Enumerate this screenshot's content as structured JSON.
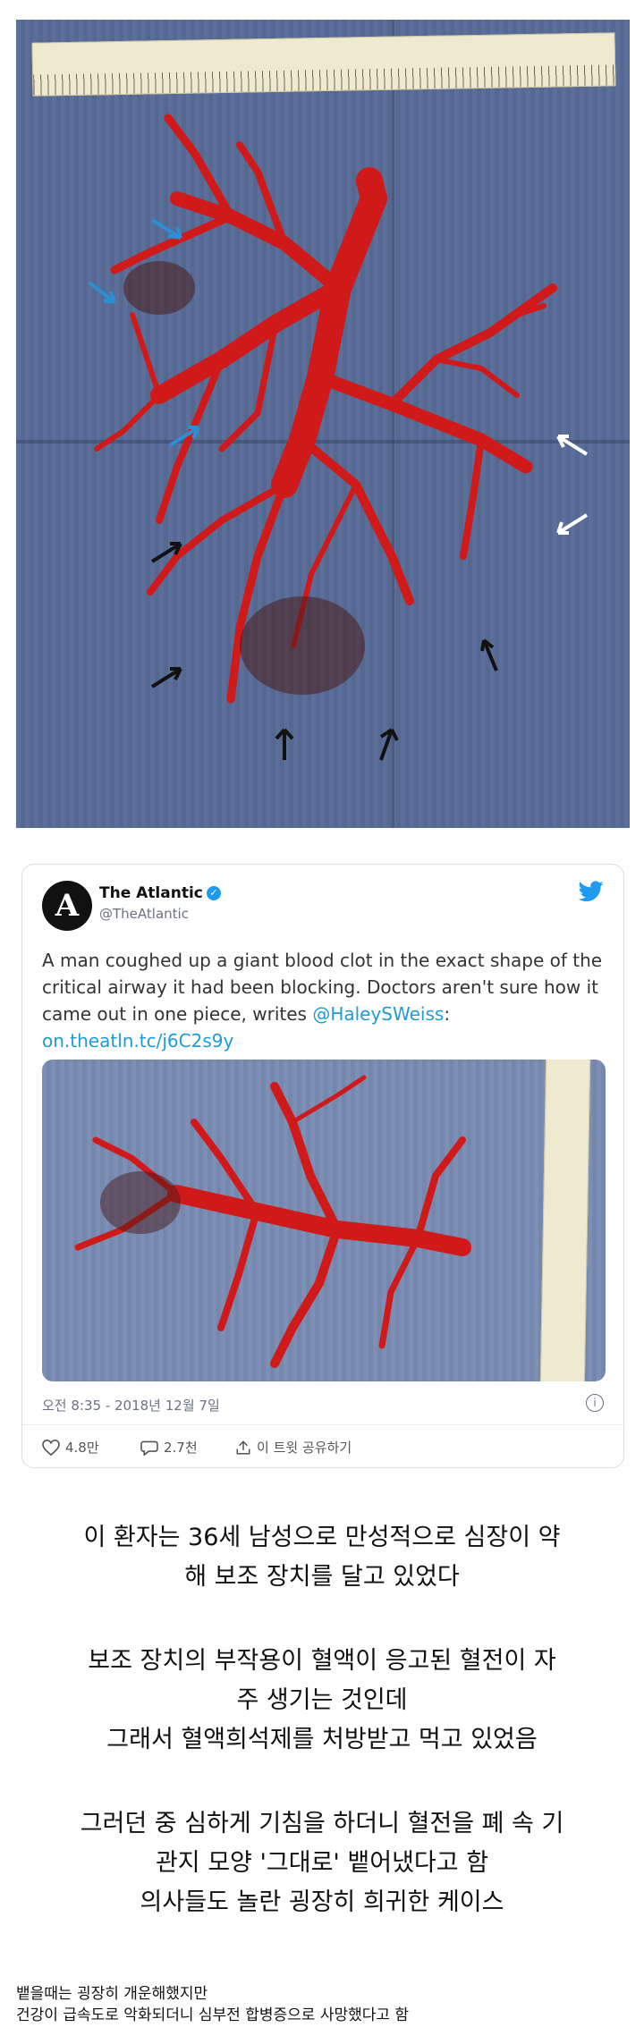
{
  "tweet": {
    "author_name": "The Atlantic",
    "handle": "@TheAtlantic",
    "avatar_letter": "A",
    "text_main": "A man coughed up a giant blood clot in the exact shape of the critical airway it had been blocking. Doctors aren't sure how it came out in one piece, writes ",
    "mention": "@HaleySWeiss",
    "text_after_mention": ":",
    "link": "on.theatln.tc/j6C2s9y",
    "timestamp": "오전 8:35 - 2018년 12월 7일",
    "likes": "4.8만",
    "replies": "2.7천",
    "share": "이 트윗 공유하기",
    "colors": {
      "verified": "#1d9bf0",
      "link": "#1f9bd7",
      "bird": "#1d9bf0"
    }
  },
  "body": {
    "p1_l1": "이 환자는 36세 남성으로 만성적으로 심장이 약",
    "p1_l2": "해 보조 장치를 달고 있었다",
    "p2_l1": "보조 장치의 부작용이 혈액이 응고된 혈전이 자",
    "p2_l2": "주 생기는 것인데",
    "p2_l3": "그래서 혈액희석제를 처방받고 먹고 있었음",
    "p3_l1": "그러던 중 심하게 기침을 하더니 혈전을 폐 속 기",
    "p3_l2": "관지 모양 '그대로' 뱉어냈다고 함",
    "p3_l3": "의사들도 놀란 굉장히 희귀한 케이스"
  },
  "footnote": {
    "l1": "뱉을때는 굉장히 개운해했지만",
    "l2": "건강이 급속도로 악화되더니 심부전 합병증으로 사망했다고 함"
  },
  "icons": [
    "heart-icon",
    "reply-icon",
    "share-icon",
    "info-icon",
    "twitter-bird-icon",
    "verified-icon",
    "arrow-icon"
  ]
}
